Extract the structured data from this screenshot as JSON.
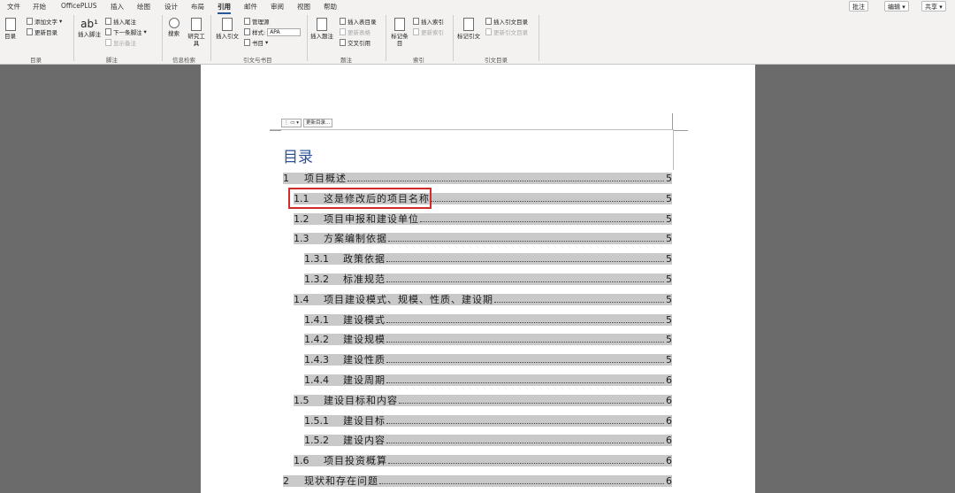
{
  "tabs": [
    "文件",
    "开始",
    "OfficePLUS",
    "插入",
    "绘图",
    "设计",
    "布局",
    "引用",
    "邮件",
    "审阅",
    "视图",
    "帮助"
  ],
  "active_tab": "引用",
  "top_right": {
    "comment": "批注",
    "edit": "编辑",
    "share": "共享"
  },
  "groups": {
    "toc": {
      "label": "目录",
      "big": "目录",
      "add_text": "添加文字",
      "update_toc": "更新目录"
    },
    "footnotes": {
      "label": "脚注",
      "big": "插入脚注",
      "insert_endnote": "插入尾注",
      "next_footnote": "下一条脚注",
      "show_notes": "显示备注"
    },
    "research": {
      "label": "信息检索",
      "search": "搜索",
      "researcher": "研究工具"
    },
    "citations": {
      "label": "引文与书目",
      "insert_citation": "插入引文",
      "manage_sources": "管理源",
      "style_label": "样式:",
      "style_value": "APA",
      "bibliography": "书目"
    },
    "captions": {
      "label": "题注",
      "insert_caption": "插入题注",
      "insert_table_of_figures": "插入表目录",
      "update_table": "更新表格",
      "cross_reference": "交叉引用"
    },
    "index": {
      "label": "索引",
      "mark_entry": "标记条目",
      "insert_index": "插入索引",
      "update_index": "更新索引"
    },
    "authorities": {
      "label": "引文目录",
      "mark_citation": "标记引文",
      "insert_toa": "插入引文目录",
      "update_toa": "更新引文目录"
    }
  },
  "toc_toolbar": {
    "update": "更新目录..."
  },
  "toc_heading": "目录",
  "toc_entries": [
    {
      "num": "1",
      "title": "项目概述",
      "page": "5"
    },
    {
      "num": "1.1",
      "title": "这是修改后的项目名称",
      "page": "5"
    },
    {
      "num": "1.2",
      "title": "项目申报和建设单位",
      "page": "5"
    },
    {
      "num": "1.3",
      "title": "方案编制依据",
      "page": "5"
    },
    {
      "num": "1.3.1",
      "title": "政策依据",
      "page": "5"
    },
    {
      "num": "1.3.2",
      "title": "标准规范",
      "page": "5"
    },
    {
      "num": "1.4",
      "title": "项目建设模式、规模、性质、建设期",
      "page": "5"
    },
    {
      "num": "1.4.1",
      "title": "建设模式",
      "page": "5"
    },
    {
      "num": "1.4.2",
      "title": "建设规模",
      "page": "5"
    },
    {
      "num": "1.4.3",
      "title": "建设性质",
      "page": "5"
    },
    {
      "num": "1.4.4",
      "title": "建设周期",
      "page": "6"
    },
    {
      "num": "1.5",
      "title": "建设目标和内容",
      "page": "6"
    },
    {
      "num": "1.5.1",
      "title": "建设目标",
      "page": "6"
    },
    {
      "num": "1.5.2",
      "title": "建设内容",
      "page": "6"
    },
    {
      "num": "1.6",
      "title": "项目投资概算",
      "page": "6"
    },
    {
      "num": "2",
      "title": "现状和存在问题",
      "page": "6"
    }
  ]
}
